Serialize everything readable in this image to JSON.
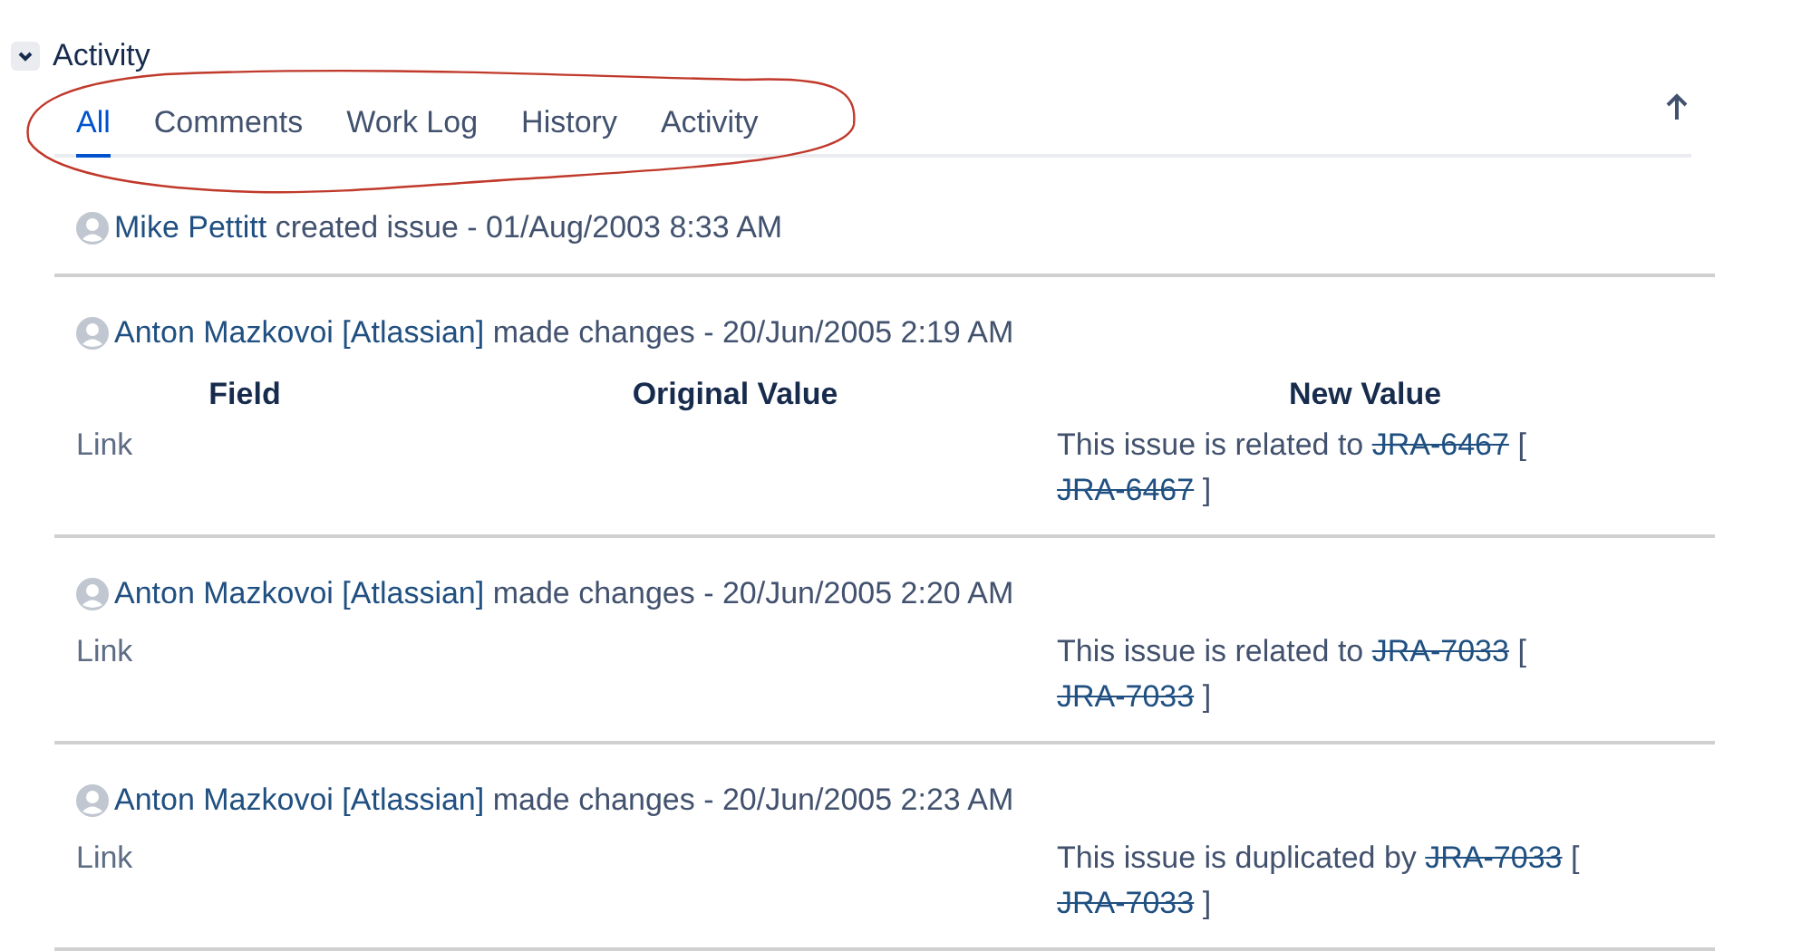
{
  "section": {
    "title": "Activity",
    "expanded": true
  },
  "tabs": [
    {
      "label": "All",
      "selected": true
    },
    {
      "label": "Comments",
      "selected": false
    },
    {
      "label": "Work Log",
      "selected": false
    },
    {
      "label": "History",
      "selected": false
    },
    {
      "label": "Activity",
      "selected": false
    }
  ],
  "annotation": {
    "kind": "ellipse",
    "color": "#c0392b"
  },
  "entries": [
    {
      "kind": "created",
      "author": "Mike Pettitt",
      "action": "created issue - 01/Aug/2003 8:33 AM"
    },
    {
      "kind": "changes",
      "author": "Anton Mazkovoi [Atlassian]",
      "action": "made changes - 20/Jun/2005 2:19 AM",
      "columns": [
        "Field",
        "Original Value",
        "New Value"
      ],
      "rows": [
        {
          "field": "Link",
          "new_value": [
            {
              "kind": "text",
              "text": "This issue is related to "
            },
            {
              "kind": "link",
              "text": "JRA-6467",
              "struck": true
            },
            {
              "kind": "text",
              "text": " [ "
            },
            {
              "kind": "link",
              "text": "JRA-6467",
              "struck": true
            },
            {
              "kind": "text",
              "text": " ]"
            }
          ]
        }
      ]
    },
    {
      "kind": "changes",
      "author": "Anton Mazkovoi [Atlassian]",
      "action": "made changes - 20/Jun/2005 2:20 AM",
      "rows": [
        {
          "field": "Link",
          "new_value": [
            {
              "kind": "text",
              "text": "This issue is related to "
            },
            {
              "kind": "link",
              "text": "JRA-7033",
              "struck": true
            },
            {
              "kind": "text",
              "text": " [ "
            },
            {
              "kind": "link",
              "text": "JRA-7033",
              "struck": true
            },
            {
              "kind": "text",
              "text": " ]"
            }
          ]
        }
      ]
    },
    {
      "kind": "changes",
      "author": "Anton Mazkovoi [Atlassian]",
      "action": "made changes - 20/Jun/2005 2:23 AM",
      "rows": [
        {
          "field": "Link",
          "new_value": [
            {
              "kind": "text",
              "text": "This issue is duplicated by "
            },
            {
              "kind": "link",
              "text": "JRA-7033",
              "struck": true
            },
            {
              "kind": "text",
              "text": " [ "
            },
            {
              "kind": "link",
              "text": "JRA-7033",
              "struck": true
            },
            {
              "kind": "text",
              "text": " ]"
            }
          ]
        }
      ]
    }
  ]
}
